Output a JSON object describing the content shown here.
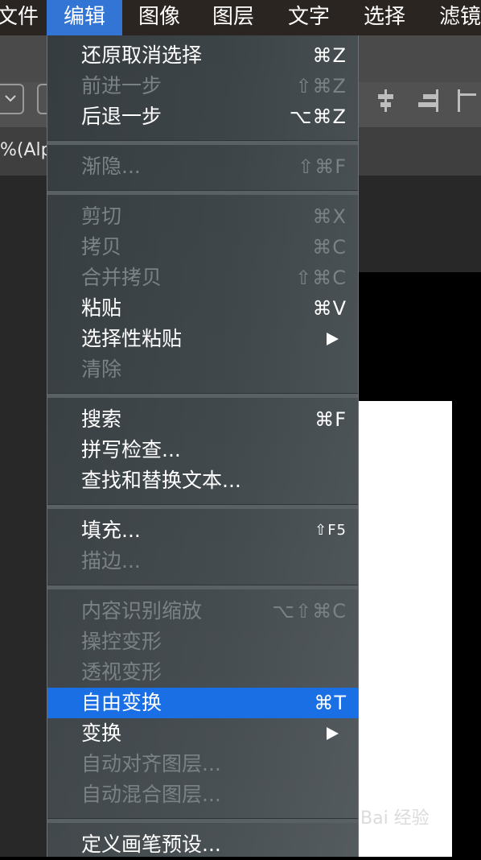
{
  "menubar": {
    "items": [
      "文件",
      "编辑",
      "图像",
      "图层",
      "文字",
      "选择",
      "滤镜"
    ],
    "active_index": 1
  },
  "document": {
    "tab_label": "%(Alp"
  },
  "watermark": "Bai 经验",
  "edit_menu": {
    "items": [
      {
        "label": "还原取消选择",
        "shortcut": "⌘Z",
        "enabled": true
      },
      {
        "label": "前进一步",
        "shortcut": "⇧⌘Z",
        "enabled": false
      },
      {
        "label": "后退一步",
        "shortcut": "⌥⌘Z",
        "enabled": true
      },
      {
        "label": "渐隐...",
        "shortcut": "⇧⌘F",
        "enabled": false
      },
      {
        "label": "剪切",
        "shortcut": "⌘X",
        "enabled": false
      },
      {
        "label": "拷贝",
        "shortcut": "⌘C",
        "enabled": false
      },
      {
        "label": "合并拷贝",
        "shortcut": "⇧⌘C",
        "enabled": false
      },
      {
        "label": "粘贴",
        "shortcut": "⌘V",
        "enabled": true
      },
      {
        "label": "选择性粘贴",
        "shortcut": "",
        "enabled": true,
        "submenu": true
      },
      {
        "label": "清除",
        "shortcut": "",
        "enabled": false
      },
      {
        "label": "搜索",
        "shortcut": "⌘F",
        "enabled": true
      },
      {
        "label": "拼写检查...",
        "shortcut": "",
        "enabled": true
      },
      {
        "label": "查找和替换文本...",
        "shortcut": "",
        "enabled": true
      },
      {
        "label": "填充...",
        "shortcut": "⇧F5",
        "enabled": true
      },
      {
        "label": "描边...",
        "shortcut": "",
        "enabled": false
      },
      {
        "label": "内容识别缩放",
        "shortcut": "⌥⇧⌘C",
        "enabled": false
      },
      {
        "label": "操控变形",
        "shortcut": "",
        "enabled": false
      },
      {
        "label": "透视变形",
        "shortcut": "",
        "enabled": false
      },
      {
        "label": "自由变换",
        "shortcut": "⌘T",
        "enabled": true,
        "highlighted": true
      },
      {
        "label": "变换",
        "shortcut": "",
        "enabled": true,
        "submenu": true
      },
      {
        "label": "自动对齐图层...",
        "shortcut": "",
        "enabled": false
      },
      {
        "label": "自动混合图层...",
        "shortcut": "",
        "enabled": false
      },
      {
        "label": "定义画笔预设...",
        "shortcut": "",
        "enabled": true
      }
    ]
  },
  "colors": {
    "highlight": "#1a6fe5",
    "menubar_active": "#3275d4",
    "disabled_text": "#7b8286"
  }
}
